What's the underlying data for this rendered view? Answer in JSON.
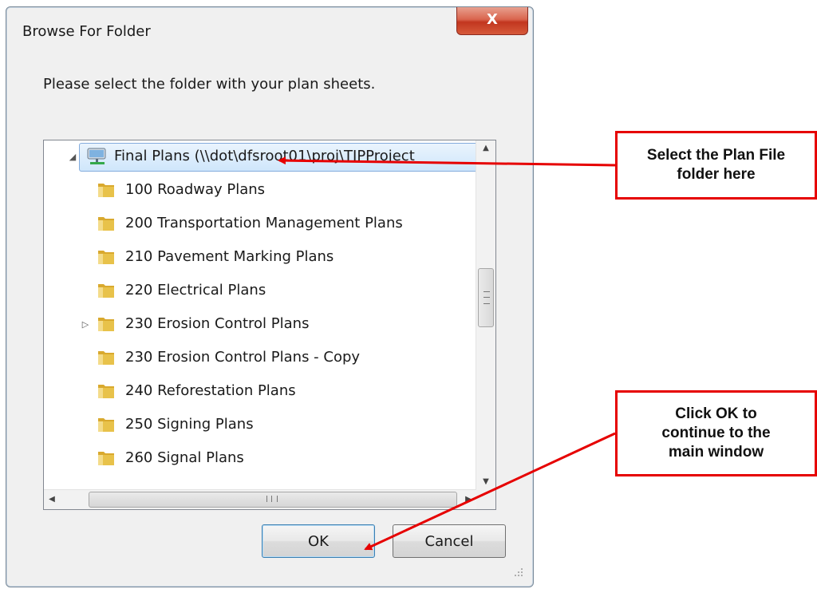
{
  "dialog": {
    "title": "Browse For Folder",
    "close_glyph": "X",
    "prompt": "Please select the folder with your plan sheets."
  },
  "tree": {
    "root": {
      "label": "Final Plans (\\\\dot\\dfsroot01\\proj\\TIPProject",
      "icon": "network-drive-icon",
      "expanded": true,
      "selected": true
    },
    "items": [
      {
        "label": "100 Roadway Plans",
        "has_children": false
      },
      {
        "label": "200 Transportation Management Plans",
        "has_children": false
      },
      {
        "label": "210 Pavement Marking Plans",
        "has_children": false
      },
      {
        "label": "220 Electrical Plans",
        "has_children": false
      },
      {
        "label": "230 Erosion Control Plans",
        "has_children": true
      },
      {
        "label": "230 Erosion Control Plans - Copy",
        "has_children": false
      },
      {
        "label": "240 Reforestation Plans",
        "has_children": false
      },
      {
        "label": "250 Signing Plans",
        "has_children": false
      },
      {
        "label": "260 Signal Plans",
        "has_children": false
      }
    ],
    "scroll_grip_glyph": "III"
  },
  "buttons": {
    "ok": "OK",
    "cancel": "Cancel"
  },
  "annotations": {
    "select_folder": "Select the Plan File folder here",
    "click_ok": "Click OK to continue to the main window"
  },
  "colors": {
    "annotation_red": "#e60000",
    "selection_blue": "#cfe6fb",
    "folder_yellow": "#e8c24a"
  }
}
